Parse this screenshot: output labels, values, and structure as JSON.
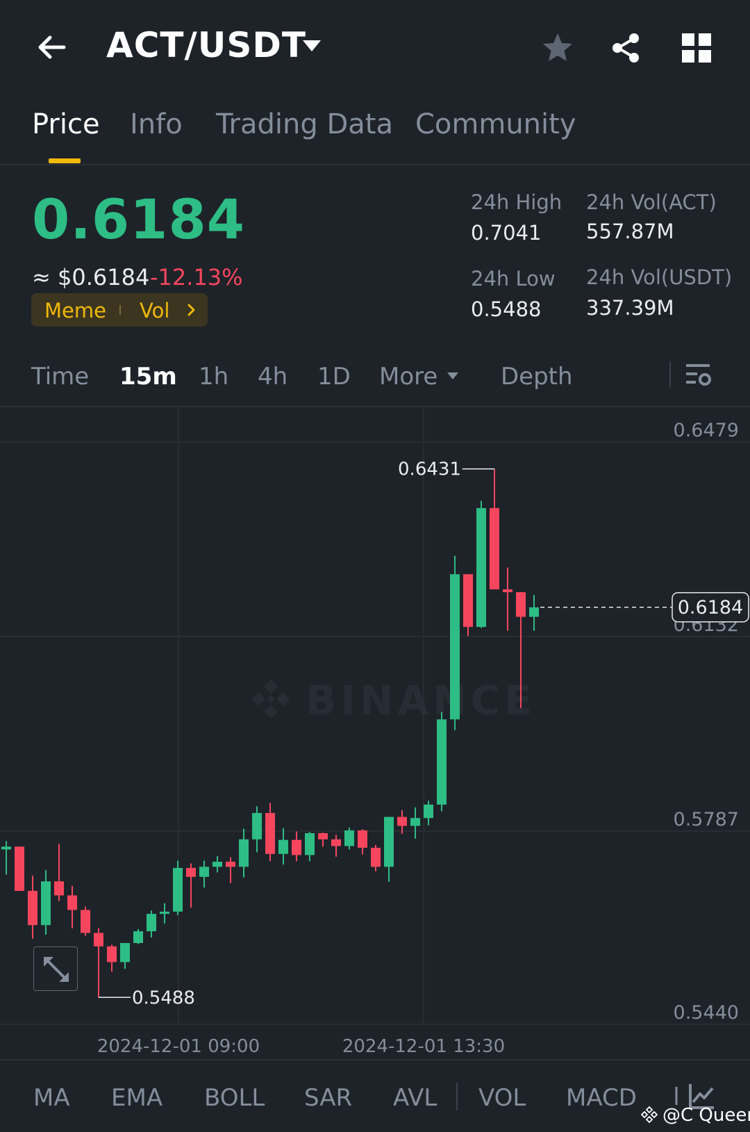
{
  "header": {
    "pair": "ACT/USDT"
  },
  "tabs": [
    "Price",
    "Info",
    "Trading Data",
    "Community"
  ],
  "price": {
    "last": "0.6184",
    "fiat": "≈ $0.6184",
    "change": "-12.13%",
    "tags": {
      "meme": "Meme",
      "vol": "Vol"
    },
    "high_label": "24h High",
    "high_value": "0.7041",
    "low_label": "24h Low",
    "low_value": "0.5488",
    "vol_act_label": "24h Vol(ACT)",
    "vol_act_value": "557.87M",
    "vol_usdt_label": "24h Vol(USDT)",
    "vol_usdt_value": "337.39M"
  },
  "intervals": {
    "time": "Time",
    "m15": "15m",
    "h1": "1h",
    "h4": "4h",
    "d1": "1D",
    "more": "More",
    "depth": "Depth"
  },
  "chart": {
    "watermark": "BINANCE",
    "y_ticks": [
      "0.6479",
      "0.6132",
      "0.5787",
      "0.5440"
    ],
    "x_ticks": [
      "2024-12-01 09:00",
      "2024-12-01 13:30"
    ],
    "current_price_label": "0.6184",
    "max_label": "0.6431",
    "min_label": "0.5488",
    "up_color": "#2ebd85",
    "down_color": "#f6465d"
  },
  "chart_data": {
    "type": "candlestick",
    "interval": "15m",
    "ylim": [
      0.544,
      0.6479
    ],
    "y_ticks": [
      0.6479,
      0.6132,
      0.5787,
      0.544
    ],
    "x_ticks": [
      "2024-12-01 09:00",
      "2024-12-01 13:30"
    ],
    "current_price": 0.6184,
    "max": 0.6431,
    "min": 0.5488,
    "candles": [
      {
        "o": 0.5752,
        "h": 0.5767,
        "l": 0.5707,
        "c": 0.5757
      },
      {
        "o": 0.5757,
        "h": 0.5757,
        "l": 0.568,
        "c": 0.5678
      },
      {
        "o": 0.5678,
        "h": 0.5705,
        "l": 0.5593,
        "c": 0.5617
      },
      {
        "o": 0.5617,
        "h": 0.5715,
        "l": 0.56,
        "c": 0.5695
      },
      {
        "o": 0.5695,
        "h": 0.5762,
        "l": 0.566,
        "c": 0.567
      },
      {
        "o": 0.567,
        "h": 0.5687,
        "l": 0.5611,
        "c": 0.5644
      },
      {
        "o": 0.5644,
        "h": 0.565,
        "l": 0.5598,
        "c": 0.5603
      },
      {
        "o": 0.5603,
        "h": 0.5612,
        "l": 0.5488,
        "c": 0.5579
      },
      {
        "o": 0.5579,
        "h": 0.5582,
        "l": 0.5534,
        "c": 0.5551
      },
      {
        "o": 0.5551,
        "h": 0.5566,
        "l": 0.5539,
        "c": 0.5585
      },
      {
        "o": 0.5585,
        "h": 0.561,
        "l": 0.5583,
        "c": 0.5606
      },
      {
        "o": 0.5606,
        "h": 0.5643,
        "l": 0.5595,
        "c": 0.5637
      },
      {
        "o": 0.5637,
        "h": 0.5656,
        "l": 0.562,
        "c": 0.5641
      },
      {
        "o": 0.5641,
        "h": 0.5732,
        "l": 0.5635,
        "c": 0.5719
      },
      {
        "o": 0.5719,
        "h": 0.5727,
        "l": 0.5648,
        "c": 0.5703
      },
      {
        "o": 0.5703,
        "h": 0.5732,
        "l": 0.5684,
        "c": 0.5721
      },
      {
        "o": 0.5721,
        "h": 0.574,
        "l": 0.5711,
        "c": 0.573
      },
      {
        "o": 0.573,
        "h": 0.5738,
        "l": 0.5692,
        "c": 0.5721
      },
      {
        "o": 0.5721,
        "h": 0.5789,
        "l": 0.5702,
        "c": 0.577
      },
      {
        "o": 0.577,
        "h": 0.5829,
        "l": 0.5747,
        "c": 0.5817
      },
      {
        "o": 0.5817,
        "h": 0.5835,
        "l": 0.5731,
        "c": 0.5744
      },
      {
        "o": 0.5744,
        "h": 0.579,
        "l": 0.5725,
        "c": 0.5769
      },
      {
        "o": 0.5769,
        "h": 0.5784,
        "l": 0.5731,
        "c": 0.5742
      },
      {
        "o": 0.5742,
        "h": 0.5783,
        "l": 0.5731,
        "c": 0.5781
      },
      {
        "o": 0.5781,
        "h": 0.5782,
        "l": 0.5757,
        "c": 0.577
      },
      {
        "o": 0.577,
        "h": 0.5778,
        "l": 0.5739,
        "c": 0.5758
      },
      {
        "o": 0.5758,
        "h": 0.5791,
        "l": 0.5752,
        "c": 0.5786
      },
      {
        "o": 0.5786,
        "h": 0.5788,
        "l": 0.5743,
        "c": 0.5755
      },
      {
        "o": 0.5755,
        "h": 0.576,
        "l": 0.5713,
        "c": 0.5721
      },
      {
        "o": 0.5721,
        "h": 0.581,
        "l": 0.5694,
        "c": 0.581
      },
      {
        "o": 0.581,
        "h": 0.5822,
        "l": 0.578,
        "c": 0.5794
      },
      {
        "o": 0.5794,
        "h": 0.5827,
        "l": 0.5771,
        "c": 0.5808
      },
      {
        "o": 0.5808,
        "h": 0.5839,
        "l": 0.5795,
        "c": 0.5832
      },
      {
        "o": 0.5832,
        "h": 0.5997,
        "l": 0.582,
        "c": 0.5984
      },
      {
        "o": 0.5984,
        "h": 0.6276,
        "l": 0.5965,
        "c": 0.6243
      },
      {
        "o": 0.6243,
        "h": 0.6241,
        "l": 0.6133,
        "c": 0.6149
      },
      {
        "o": 0.6149,
        "h": 0.6374,
        "l": 0.6147,
        "c": 0.6361
      },
      {
        "o": 0.6361,
        "h": 0.6431,
        "l": 0.6281,
        "c": 0.6216
      },
      {
        "o": 0.6216,
        "h": 0.6255,
        "l": 0.6142,
        "c": 0.6211
      },
      {
        "o": 0.6211,
        "h": 0.6173,
        "l": 0.6004,
        "c": 0.6167
      },
      {
        "o": 0.6167,
        "h": 0.6206,
        "l": 0.6142,
        "c": 0.6184
      }
    ]
  },
  "indicators": [
    "MA",
    "EMA",
    "BOLL",
    "SAR",
    "AVL",
    "VOL",
    "MACD"
  ],
  "credit": "@C Queen"
}
